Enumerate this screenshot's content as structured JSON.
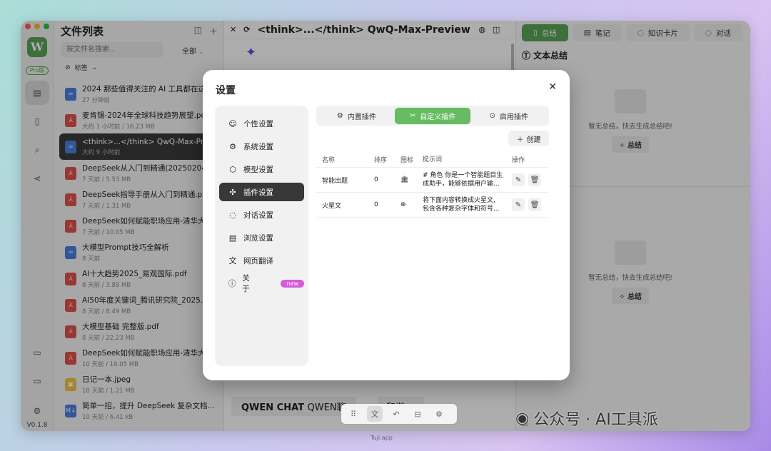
{
  "app": {
    "version": "V0.1.8",
    "pro_badge": "Pro版",
    "logo": "W",
    "watermark": "Tuji.app"
  },
  "file_panel": {
    "title": "文件列表",
    "search_placeholder": "按文件名搜索...",
    "filter": "全部",
    "tags_label": "标签",
    "files": [
      {
        "name": "2024 那些值得关注的 AI 工具都在这儿",
        "meta": "27 分钟前",
        "type": "link"
      },
      {
        "name": "麦肯锡-2024年全球科技趋势展望.pdf",
        "meta": "大约 1 小时前 / 16.23 MB",
        "type": "pdf"
      },
      {
        "name": "<think>...</think> QwQ-Max-Previe...",
        "meta": "大约 9 小时前",
        "type": "link",
        "selected": true
      },
      {
        "name": "DeepSeek从入门到精通(20250204).pdf",
        "meta": "7 天前 / 5.53 MB",
        "type": "pdf"
      },
      {
        "name": "DeepSeek指导手册从入门到精通.pdf",
        "meta": "7 天前 / 1.31 MB",
        "type": "pdf"
      },
      {
        "name": "DeepSeek如何赋能职场应用-清华大...",
        "meta": "7 天前 / 10.05 MB",
        "type": "pdf"
      },
      {
        "name": "大模型Prompt技巧全解析",
        "meta": "8 天前",
        "type": "link"
      },
      {
        "name": "AI十大趋势2025_易观国际.pdf",
        "meta": "8 天前 / 3.89 MB",
        "type": "pdf"
      },
      {
        "name": "AI50年度关键词_腾讯研究院_2025.01",
        "meta": "8 天前 / 8.49 MB",
        "type": "pdf"
      },
      {
        "name": "大模型基础 完整版.pdf",
        "meta": "8 天前 / 22.23 MB",
        "type": "pdf"
      },
      {
        "name": "DeepSeek如何赋能职场应用-清华大...",
        "meta": "10 天前 / 10.05 MB",
        "type": "pdf"
      },
      {
        "name": "日记一本.jpeg",
        "meta": "10 天前 / 1.21 MB",
        "type": "image"
      },
      {
        "name": "简单一招，提升 DeepSeek 复杂文档...",
        "meta": "10 天前 / 6.41 kB",
        "type": "md"
      }
    ]
  },
  "main": {
    "title": "<think>...</think> QwQ-Max-Preview | Q...",
    "qwen_chat": "QWEN CHAT",
    "qwen_chat_suffix": "QWEN聊",
    "qwen_right": "和谐 ↗"
  },
  "right_panel": {
    "tabs": [
      "总结",
      "笔记",
      "知识卡片",
      "对话"
    ],
    "text_summary_title": "文本总结",
    "section2_title": "总结",
    "empty_msg": "暂无总结，快去生成总结吧!",
    "summarize_btn": "总结"
  },
  "watermark_text": "公众号 · AI工具派",
  "dialog": {
    "title": "设置",
    "nav": [
      {
        "label": "个性设置",
        "icon": "user-icon"
      },
      {
        "label": "系统设置",
        "icon": "gear-icon"
      },
      {
        "label": "模型设置",
        "icon": "cube-icon"
      },
      {
        "label": "插件设置",
        "icon": "puzzle-icon",
        "active": true
      },
      {
        "label": "对话设置",
        "icon": "chat-icon"
      },
      {
        "label": "浏览设置",
        "icon": "document-icon"
      },
      {
        "label": "网页翻译",
        "icon": "translate-icon"
      },
      {
        "label": "关于",
        "icon": "info-icon",
        "badge": "new"
      }
    ],
    "plugin_tabs": [
      "内置插件",
      "自定义插件",
      "启用插件"
    ],
    "create_label": "创建",
    "columns": [
      "名称",
      "排序",
      "图标",
      "提示词",
      "操作"
    ],
    "rows": [
      {
        "name": "智能出题",
        "order": "0",
        "icon": "🏛",
        "prompt1": "# 角色 你是一个智能题目生",
        "prompt2": "成助手，能够依据用户输..."
      },
      {
        "name": "火星文",
        "order": "0",
        "icon": "⊕",
        "prompt1": "将下面内容转换成火星文,",
        "prompt2": "包含各种复杂字体和符号..."
      }
    ]
  },
  "colors": {
    "accent": "#5aa457",
    "active_nav": "#383838",
    "active_tab": "#67bb63",
    "badge": "#d45cd9"
  }
}
